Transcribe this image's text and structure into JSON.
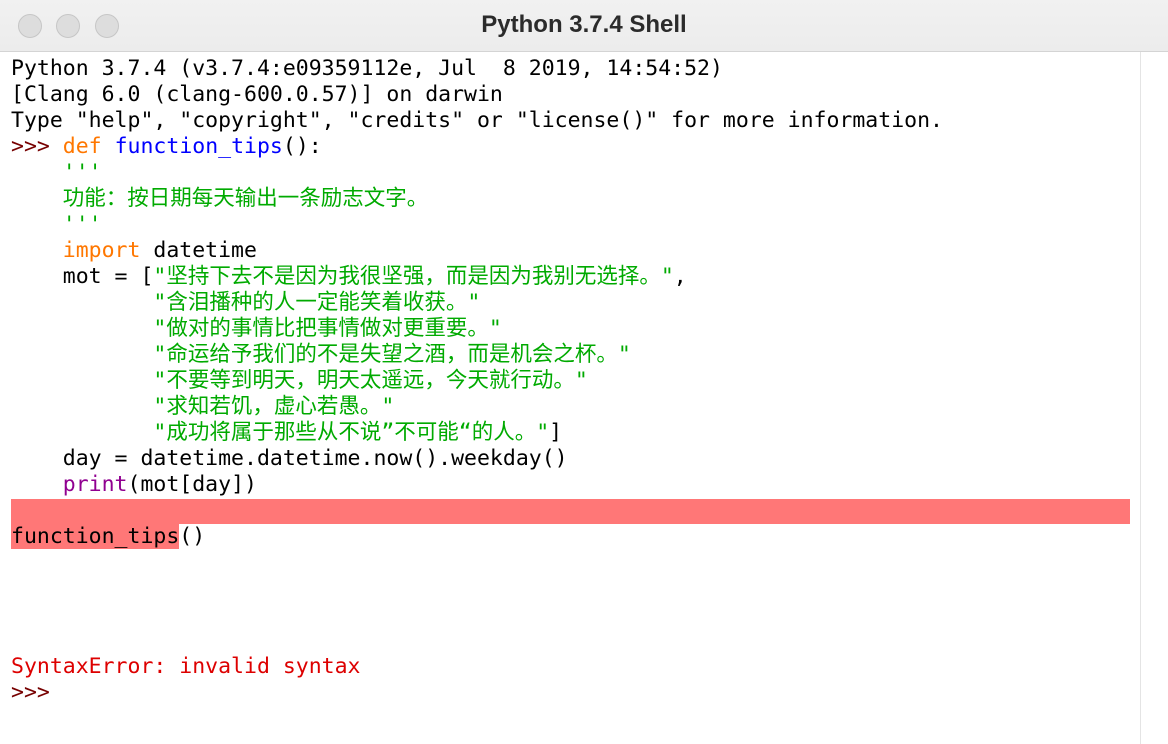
{
  "window": {
    "title": "Python 3.7.4 Shell"
  },
  "shell": {
    "banner": [
      "Python 3.7.4 (v3.7.4:e09359112e, Jul  8 2019, 14:54:52)",
      "[Clang 6.0 (clang-600.0.57)] on darwin",
      "Type \"help\", \"copyright\", \"credits\" or \"license()\" for more information."
    ],
    "prompt": ">>>",
    "code": {
      "def_keyword": "def",
      "func_name": "function_tips",
      "def_suffix": "():",
      "doc_open": "'''",
      "doc_text": "功能：按日期每天输出一条励志文字。",
      "doc_close": "'''",
      "import_keyword": "import",
      "import_module": " datetime",
      "mot_prefix": "mot = [",
      "mot_items": [
        "\"坚持下去不是因为我很坚强，而是因为我别无选择。\"",
        "\"含泪播种的人一定能笑着收获。\"",
        "\"做对的事情比把事情做对更重要。\"",
        "\"命运给予我们的不是失望之酒，而是机会之杯。\"",
        "\"不要等到明天，明天太遥远，今天就行动。\"",
        "\"求知若饥，虚心若愚。\"",
        "\"成功将属于那些从不说”不可能“的人。\""
      ],
      "mot_first_suffix": ",",
      "mot_last_suffix": "]",
      "day_line": "day = datetime.datetime.now().weekday()",
      "print_builtin": "print",
      "print_args": "(mot[day])",
      "call_name": "function_tips",
      "call_suffix": "()"
    },
    "error": "SyntaxError: invalid syntax",
    "final_prompt": ">>>"
  }
}
